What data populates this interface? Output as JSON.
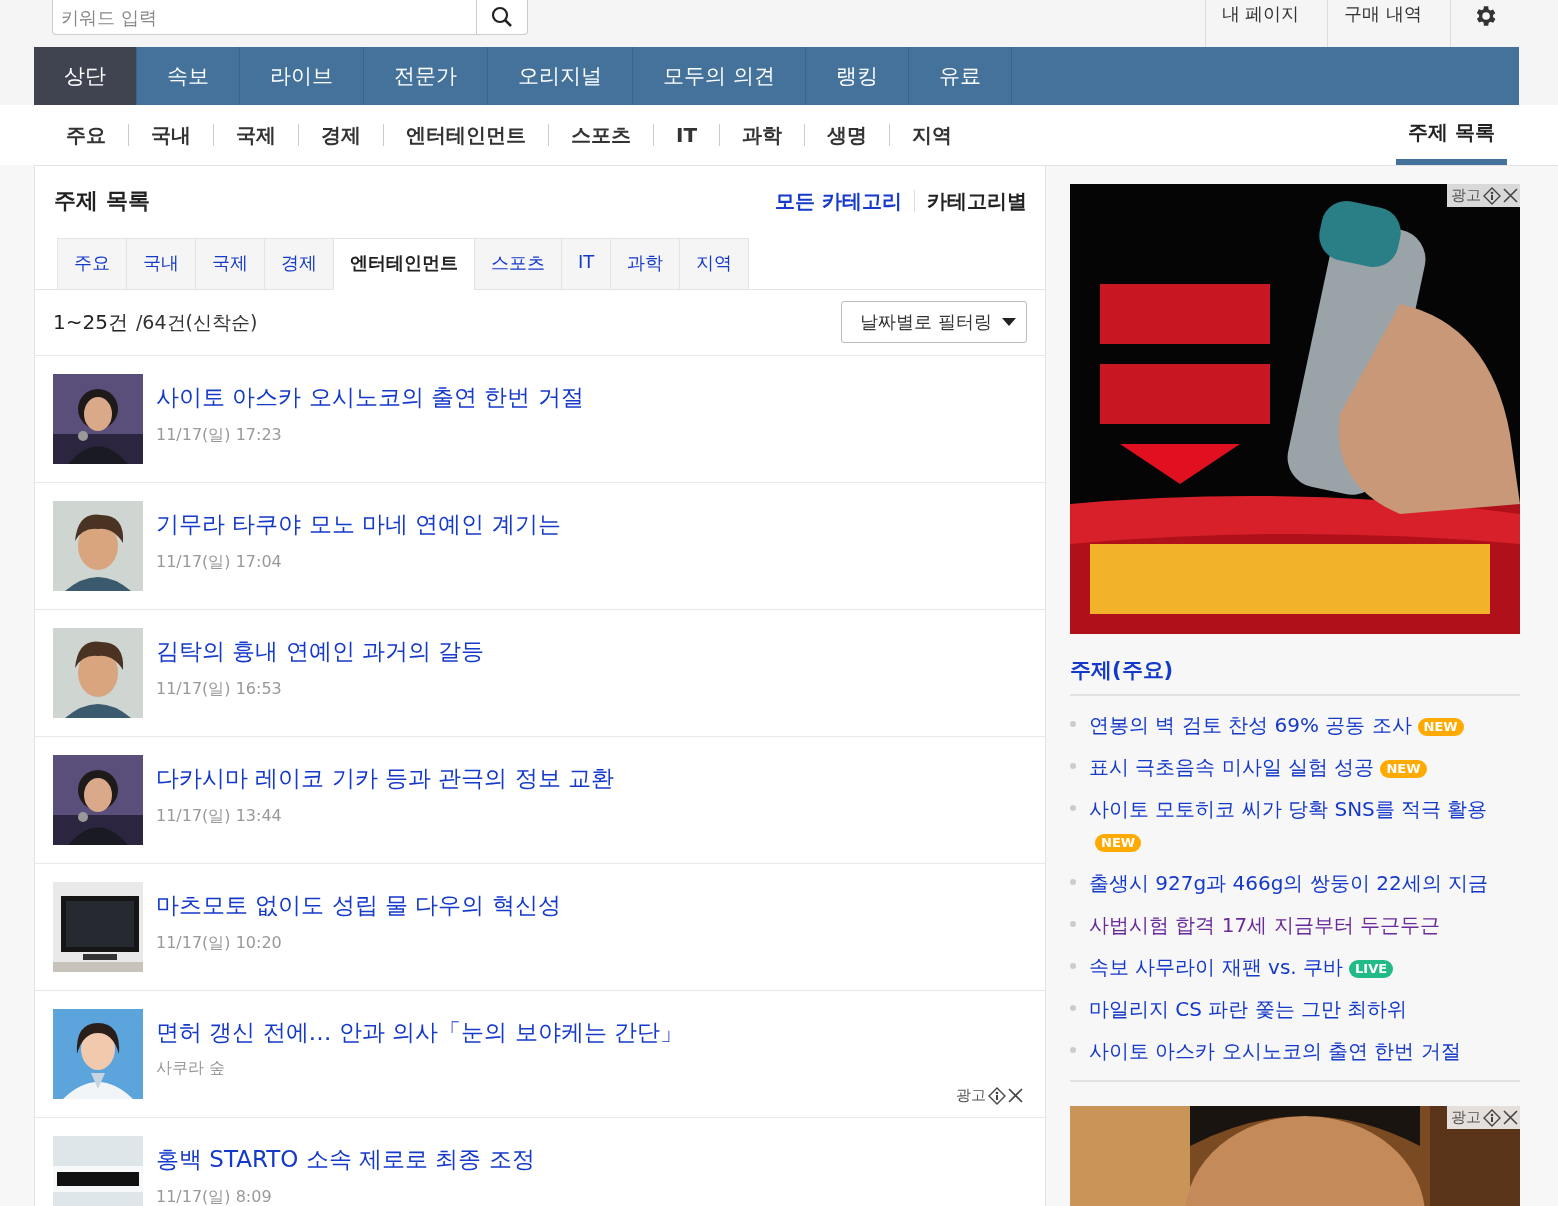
{
  "header": {
    "search": {
      "placeholder": "키워드 입력"
    },
    "links": [
      "내 페이지",
      "구매 내역"
    ]
  },
  "main_nav": [
    {
      "label": "상단",
      "selected": true
    },
    {
      "label": "속보",
      "selected": false
    },
    {
      "label": "라이브",
      "selected": false
    },
    {
      "label": "전문가",
      "selected": false
    },
    {
      "label": "오리지널",
      "selected": false
    },
    {
      "label": "모두의 의견",
      "selected": false
    },
    {
      "label": "랭킹",
      "selected": false
    },
    {
      "label": "유료",
      "selected": false
    }
  ],
  "sub_nav": {
    "items": [
      "주요",
      "국내",
      "국제",
      "경제",
      "엔터테인먼트",
      "스포츠",
      "IT",
      "과학",
      "생명",
      "지역"
    ],
    "current": {
      "label": "주제 목록",
      "selected": true
    }
  },
  "topics": {
    "title": "주제 목록",
    "links": [
      {
        "label": "모든 카테고리",
        "selected": true
      },
      {
        "label": "카테고리별",
        "selected": false
      }
    ],
    "tabs": [
      {
        "label": "주요",
        "selected": false
      },
      {
        "label": "국내",
        "selected": false
      },
      {
        "label": "국제",
        "selected": false
      },
      {
        "label": "경제",
        "selected": false
      },
      {
        "label": "엔터테인먼트",
        "selected": true
      },
      {
        "label": "스포츠",
        "selected": false
      },
      {
        "label": "IT",
        "selected": false
      },
      {
        "label": "과학",
        "selected": false
      },
      {
        "label": "지역",
        "selected": false
      }
    ],
    "count": {
      "range": "1~25건",
      "total": "/64건(신착순)"
    },
    "filter": "날짜별로 필터링",
    "articles": [
      {
        "kind": "news",
        "title": "사이토 아스카 오시노코의 출연 한번 거절",
        "meta": "11/17(일) 17:23"
      },
      {
        "kind": "news",
        "title": "기무라 타쿠야 모노 마네 연예인 계기는",
        "meta": "11/17(일) 17:04"
      },
      {
        "kind": "news",
        "title": "김탁의 흉내 연예인 과거의 갈등",
        "meta": "11/17(일) 16:53"
      },
      {
        "kind": "news",
        "title": "다카시마 레이코 기카 등과 관극의 정보 교환",
        "meta": "11/17(일) 13:44"
      },
      {
        "kind": "news",
        "title": "마츠모토 없이도 성립 물 다우의 혁신성",
        "meta": "11/17(일) 10:20"
      },
      {
        "kind": "ad",
        "title": "면허 갱신 전에… 안과 의사「눈의 보야케는 간단」",
        "meta": "사쿠라 숲",
        "ad_label": "광고"
      },
      {
        "kind": "news",
        "title": "홍백 STARTO 소속 제로로 최종 조정",
        "meta": "11/17(일) 8:09"
      }
    ]
  },
  "sidebar": {
    "ad_label": "광고",
    "ranking": {
      "title": "주제(주요)",
      "items": [
        {
          "text": "연봉의 벽 검토 찬성 69% 공동 조사",
          "visited": false,
          "badge": {
            "kind": "new",
            "text": "NEW"
          }
        },
        {
          "text": "표시 극초음속 미사일 실험 성공",
          "visited": false,
          "badge": {
            "kind": "new",
            "text": "NEW"
          }
        },
        {
          "text": "사이토 모토히코 씨가 당확 SNS를 적극 활용",
          "visited": false,
          "badge": {
            "kind": "new",
            "text": "NEW"
          }
        },
        {
          "text": "출생시 927g과 466g의 쌍둥이 22세의 지금",
          "visited": false
        },
        {
          "text": "사법시험 합격 17세 지금부터 두근두근",
          "visited": true
        },
        {
          "text": "속보 사무라이 재팬 vs. 쿠바",
          "visited": false,
          "badge": {
            "kind": "live",
            "text": "LIVE"
          }
        },
        {
          "text": "마일리지 CS 파란 쫓는 그만 최하위",
          "visited": false
        },
        {
          "text": "사이토 아스카 오시노코의 출연 한번 거절",
          "visited": false
        }
      ]
    },
    "ad2_label": "광고"
  }
}
